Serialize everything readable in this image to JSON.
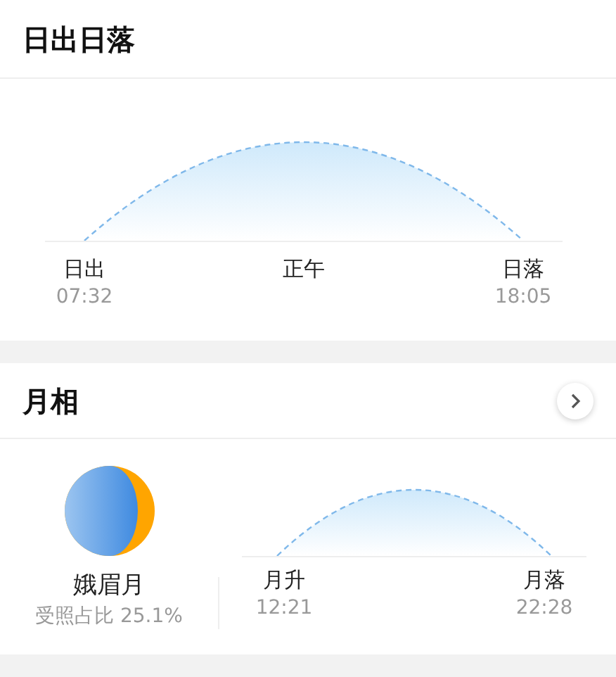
{
  "sun": {
    "title": "日出日落",
    "points": [
      {
        "label": "日出",
        "time": "07:32"
      },
      {
        "label": "正午"
      },
      {
        "label": "日落",
        "time": "18:05"
      }
    ]
  },
  "moon": {
    "title": "月相",
    "phase_name": "娥眉月",
    "illumination": "受照占比 25.1%",
    "rise": {
      "label": "月升",
      "time": "12:21"
    },
    "set": {
      "label": "月落",
      "time": "22:28"
    }
  }
}
